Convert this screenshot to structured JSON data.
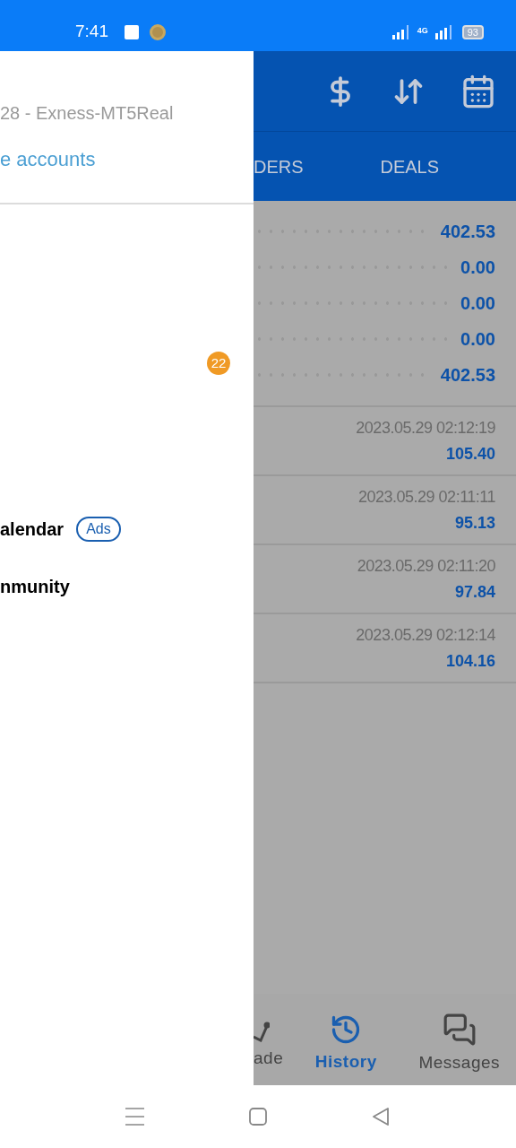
{
  "status_bar": {
    "time": "7:41",
    "network": "4G",
    "battery": "93"
  },
  "drawer": {
    "account": "28 - Exness-MT5Real",
    "accounts_link": "e accounts",
    "badge": "22",
    "items": [
      {
        "label": "alendar",
        "tag": "Ads"
      },
      {
        "label": "nmunity"
      }
    ]
  },
  "tabs": [
    "DERS",
    "DEALS"
  ],
  "summary": [
    "402.53",
    "0.00",
    "0.00",
    "0.00",
    "402.53"
  ],
  "deals": [
    {
      "time": "2023.05.29 02:12:19",
      "amount": "105.40"
    },
    {
      "time": "2023.05.29 02:11:11",
      "amount": "95.13"
    },
    {
      "time": "2023.05.29 02:11:20",
      "amount": "97.84"
    },
    {
      "time": "2023.05.29 02:12:14",
      "amount": "104.16"
    }
  ],
  "bottom_nav": [
    {
      "label": "ade",
      "kind": "trade",
      "selected": false
    },
    {
      "label": "History",
      "kind": "history",
      "selected": true
    },
    {
      "label": "Messages",
      "kind": "messages",
      "selected": false
    }
  ]
}
